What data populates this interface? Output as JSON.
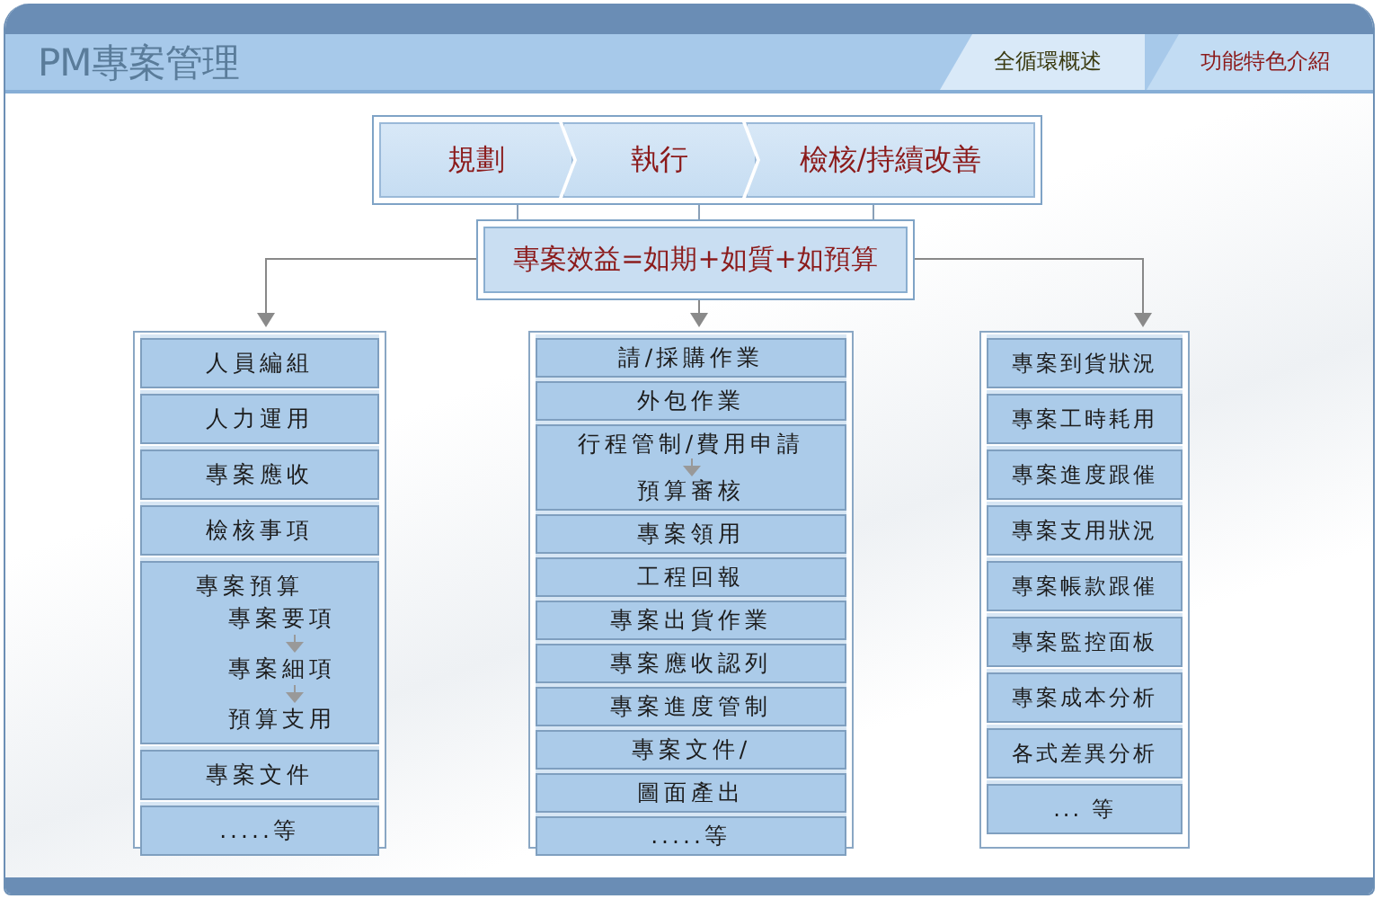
{
  "header": {
    "title": "PM專案管理",
    "tabs": [
      {
        "label": "全循環概述",
        "selected": true
      },
      {
        "label": "功能特色介紹",
        "selected": false
      }
    ]
  },
  "phases": [
    "規劃",
    "執行",
    "檢核/持續改善"
  ],
  "benefit": "專案效益=如期+如質+如預算",
  "columns": [
    {
      "items": [
        {
          "kind": "text",
          "label": "人員編組"
        },
        {
          "kind": "text",
          "label": "人力運用"
        },
        {
          "kind": "text",
          "label": "專案應收"
        },
        {
          "kind": "text",
          "label": "檢核事項"
        },
        {
          "kind": "nested",
          "label": "專案預算",
          "steps": [
            "專案要項",
            "專案細項",
            "預算支用"
          ]
        },
        {
          "kind": "text",
          "label": "專案文件"
        },
        {
          "kind": "text",
          "label": ".....等"
        }
      ]
    },
    {
      "items": [
        {
          "kind": "text",
          "label": "請/採購作業"
        },
        {
          "kind": "text",
          "label": "外包作業"
        },
        {
          "kind": "chain",
          "steps": [
            "行程管制/費用申請",
            "預算審核"
          ]
        },
        {
          "kind": "text",
          "label": "專案領用"
        },
        {
          "kind": "text",
          "label": "工程回報"
        },
        {
          "kind": "text",
          "label": "專案出貨作業"
        },
        {
          "kind": "text",
          "label": "專案應收認列"
        },
        {
          "kind": "text",
          "label": "專案進度管制"
        },
        {
          "kind": "text",
          "label": "專案文件/"
        },
        {
          "kind": "text",
          "label": "圖面產出"
        },
        {
          "kind": "text",
          "label": ".....等"
        }
      ]
    },
    {
      "items": [
        {
          "kind": "text",
          "label": "專案到貨狀況"
        },
        {
          "kind": "text",
          "label": "專案工時耗用"
        },
        {
          "kind": "text",
          "label": "專案進度跟催"
        },
        {
          "kind": "text",
          "label": "專案支用狀況"
        },
        {
          "kind": "text",
          "label": "專案帳款跟催"
        },
        {
          "kind": "text",
          "label": "專案監控面板"
        },
        {
          "kind": "text",
          "label": "專案成本分析"
        },
        {
          "kind": "text",
          "label": "各式差異分析"
        },
        {
          "kind": "text",
          "label": "... 等"
        }
      ]
    }
  ]
}
